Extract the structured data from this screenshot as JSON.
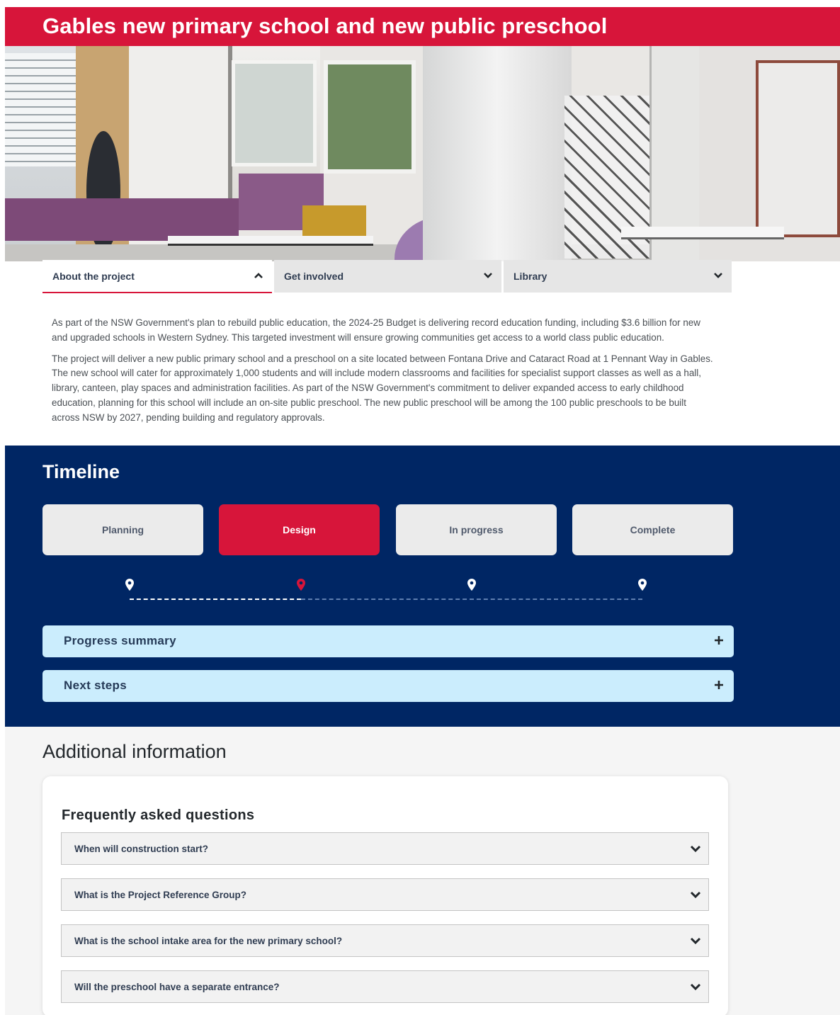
{
  "page": {
    "title": "Gables new primary school and new public preschool"
  },
  "tabs": [
    {
      "label": "About the project",
      "icon": "chevron-up-icon",
      "active": true
    },
    {
      "label": "Get involved",
      "icon": "chevron-down-icon",
      "active": false
    },
    {
      "label": "Library",
      "icon": "chevron-down-icon",
      "active": false
    }
  ],
  "intro": {
    "paragraphs": [
      "As part of the NSW Government's plan to rebuild public education, the 2024-25 Budget is delivering record education funding, including $3.6 billion for new and upgraded schools in Western Sydney. This targeted investment will ensure growing communities get access to a world class public education.",
      "The project will deliver a new public primary school and a preschool on a site located between Fontana Drive and Cataract Road at 1 Pennant Way in Gables. The new school will cater for approximately 1,000 students and will include modern classrooms and facilities for specialist support classes as well as a hall, library, canteen, play spaces and administration facilities.    As part of the NSW Government's commitment to deliver expanded access to early childhood education, planning for this school will include an on-site public preschool. The new public preschool will be among the 100 public preschools to be built across NSW by 2027, pending building and regulatory approvals."
    ]
  },
  "timeline": {
    "heading": "Timeline",
    "stages": [
      {
        "label": "Planning",
        "status": "done"
      },
      {
        "label": "Design",
        "status": "current"
      },
      {
        "label": "In progress",
        "status": "upcoming"
      },
      {
        "label": "Complete",
        "status": "upcoming"
      }
    ],
    "accordions": [
      {
        "label": "Progress summary",
        "icon": "plus-icon"
      },
      {
        "label": "Next steps",
        "icon": "plus-icon"
      }
    ]
  },
  "additional": {
    "heading": "Additional information",
    "faq": {
      "heading": "Frequently asked questions",
      "items": [
        "When will construction start?",
        "What is the Project Reference Group?",
        "What is the school intake area for the new primary school?",
        "Will the preschool have a separate entrance?"
      ]
    }
  },
  "colors": {
    "brand_red": "#d7153a",
    "navy": "#002664",
    "light_blue": "#cbedfd",
    "stage_grey": "#ebebeb"
  }
}
